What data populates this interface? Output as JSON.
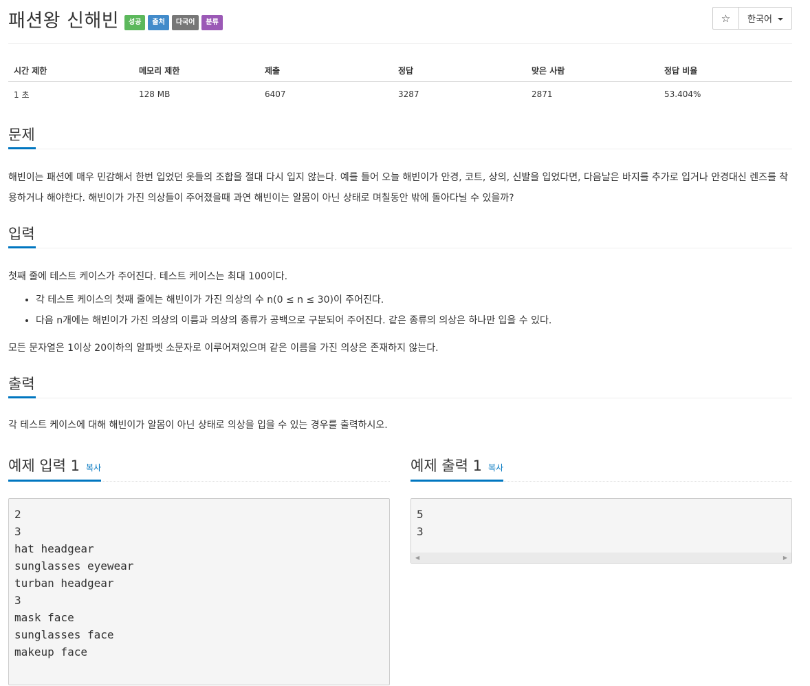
{
  "problem": {
    "title": "패션왕 신해빈",
    "labels": [
      "성공",
      "출처",
      "다국어",
      "분류"
    ]
  },
  "toolbar": {
    "star_icon": "☆",
    "language": "한국어"
  },
  "info_table": {
    "headers": [
      "시간 제한",
      "메모리 제한",
      "제출",
      "정답",
      "맞은 사람",
      "정답 비율"
    ],
    "values": [
      "1 초",
      "128 MB",
      "6407",
      "3287",
      "2871",
      "53.404%"
    ]
  },
  "sections": {
    "problem": {
      "heading": "문제",
      "text": "해빈이는 패션에 매우 민감해서 한번 입었던 옷들의 조합을 절대 다시 입지 않는다. 예를 들어 오늘 해빈이가 안경, 코트, 상의, 신발을 입었다면, 다음날은 바지를 추가로 입거나 안경대신 렌즈를 착용하거나 해야한다. 해빈이가 가진 의상들이 주어졌을때 과연 해빈이는 알몸이 아닌 상태로 며칠동안 밖에 돌아다닐 수 있을까?"
    },
    "input": {
      "heading": "입력",
      "intro": "첫째 줄에 테스트 케이스가 주어진다. 테스트 케이스는 최대 100이다.",
      "items": [
        "각 테스트 케이스의 첫째 줄에는 해빈이가 가진 의상의 수 n(0 ≤ n ≤ 30)이 주어진다.",
        "다음 n개에는 해빈이가 가진 의상의 이름과 의상의 종류가 공백으로 구분되어 주어진다. 같은 종류의 의상은 하나만 입을 수 있다."
      ],
      "outro": "모든 문자열은 1이상 20이하의 알파벳 소문자로 이루어져있으며 같은 이름을 가진 의상은 존재하지 않는다."
    },
    "output": {
      "heading": "출력",
      "text": "각 테스트 케이스에 대해 해빈이가 알몸이 아닌 상태로 의상을 입을 수 있는 경우를 출력하시오."
    }
  },
  "examples": {
    "input": {
      "heading": "예제 입력 1",
      "copy": "복사",
      "content": "2\n3\nhat headgear\nsunglasses eyewear\nturban headgear\n3\nmask face\nsunglasses face\nmakeup face"
    },
    "output": {
      "heading": "예제 출력 1",
      "copy": "복사",
      "content": "5\n3"
    }
  },
  "colors": {
    "accent": "#0076c0",
    "label_success": "#5cb85c",
    "label_source": "#428bca",
    "label_lang": "#777777",
    "label_category": "#9b59b6"
  }
}
